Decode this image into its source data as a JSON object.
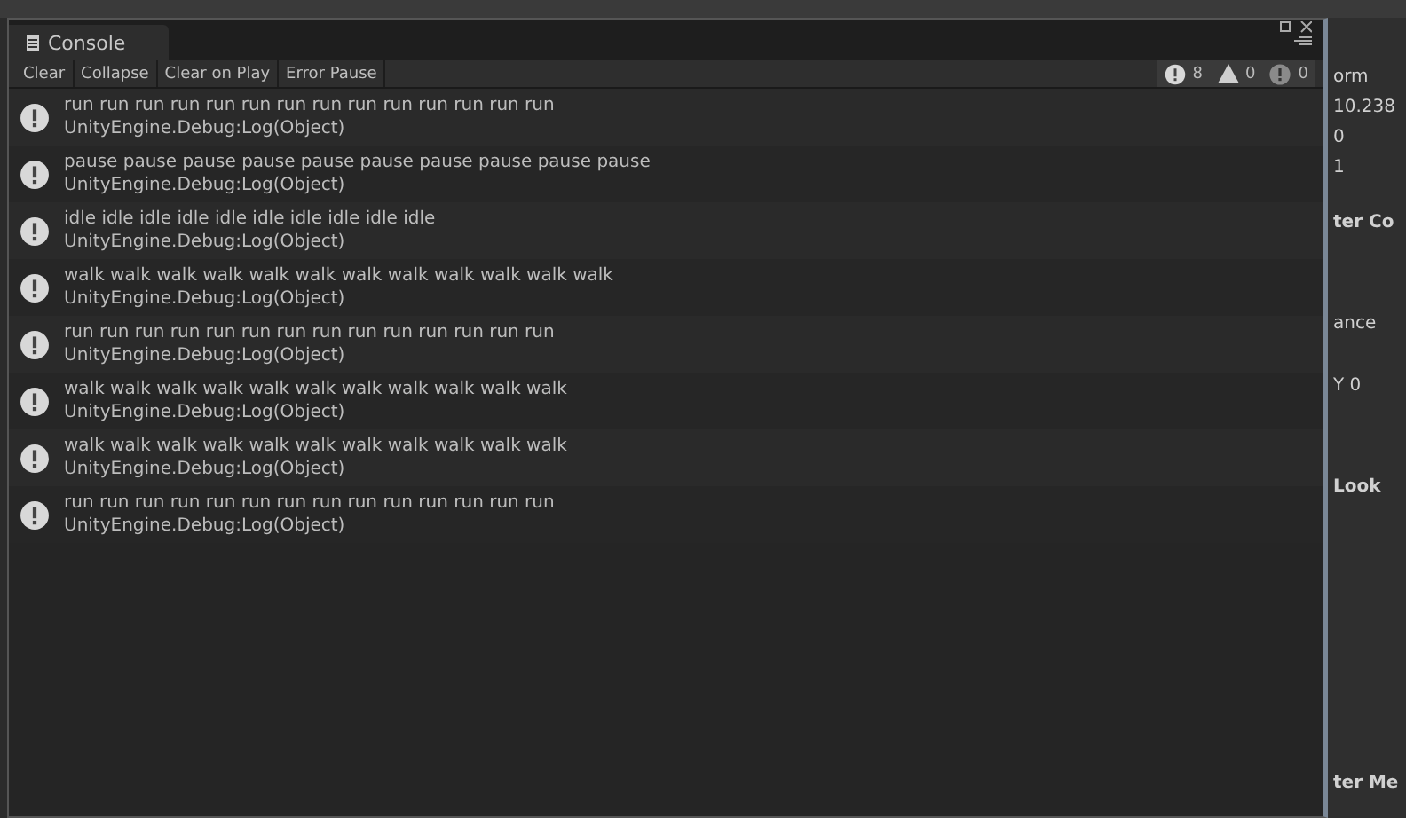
{
  "window": {
    "title": "Console"
  },
  "toolbar": {
    "buttons": [
      "Clear",
      "Collapse",
      "Clear on Play",
      "Error Pause"
    ],
    "counters": [
      {
        "kind": "info",
        "count": "8"
      },
      {
        "kind": "warning",
        "count": "0"
      },
      {
        "kind": "error",
        "count": "0"
      }
    ]
  },
  "log": [
    {
      "message": "run run run run run run run run run run run run run run",
      "trace": "UnityEngine.Debug:Log(Object)"
    },
    {
      "message": "pause pause pause pause pause pause pause pause pause pause",
      "trace": "UnityEngine.Debug:Log(Object)"
    },
    {
      "message": "idle idle idle idle idle idle idle idle idle idle",
      "trace": "UnityEngine.Debug:Log(Object)"
    },
    {
      "message": "walk walk walk walk walk walk walk walk walk walk walk walk",
      "trace": "UnityEngine.Debug:Log(Object)"
    },
    {
      "message": "run run run run run run run run run run run run run run",
      "trace": "UnityEngine.Debug:Log(Object)"
    },
    {
      "message": "walk walk walk walk walk walk walk walk walk walk walk",
      "trace": "UnityEngine.Debug:Log(Object)"
    },
    {
      "message": "walk walk walk walk walk walk walk walk walk walk walk",
      "trace": "UnityEngine.Debug:Log(Object)"
    },
    {
      "message": "run run run run run run run run run run run run run run",
      "trace": "UnityEngine.Debug:Log(Object)"
    }
  ],
  "inspector_behind": [
    "orm",
    "10.238",
    "0",
    "1",
    "ter Co",
    "ance",
    "Y 0",
    "Look",
    "ter Me"
  ]
}
